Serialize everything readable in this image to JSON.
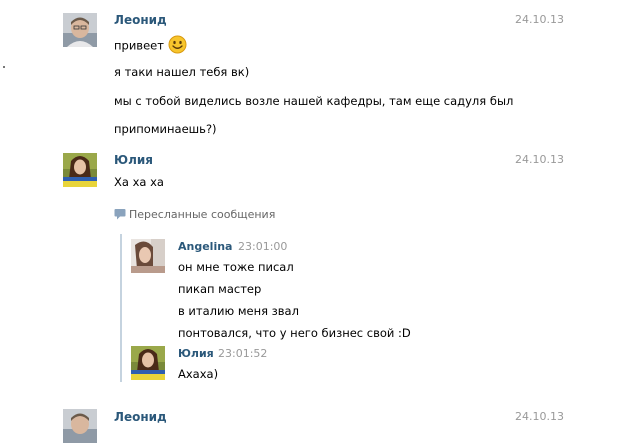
{
  "messages": [
    {
      "author": "Леонид",
      "date": "24.10.13",
      "lines": [
        "привеет",
        "я таки нашел тебя вк)",
        "мы с тобой виделись возле нашей кафедры, там еще садуля был",
        "припоминаешь?)"
      ],
      "emoji": "smiling-face-emoji"
    },
    {
      "author": "Юлия",
      "date": "24.10.13",
      "lines": [
        "Ха ха ха"
      ],
      "forwarded_label": "Пересланные сообщения",
      "forwarded": [
        {
          "author": "Angelina",
          "time": "23:01:00",
          "lines": [
            "он мне тоже писал",
            "пикап мастер",
            "в италию меня звал",
            "понтовался, что у него бизнес свой :D"
          ]
        },
        {
          "author": "Юлия",
          "time": "23:01:52",
          "lines": [
            "Ахаха)"
          ]
        }
      ]
    },
    {
      "author": "Леонид",
      "date": "24.10.13",
      "lines": []
    }
  ],
  "icons": {
    "forward_icon": "speech-bubble-icon"
  },
  "colors": {
    "author_link": "#2b587a",
    "date": "#999999",
    "forward_bar": "#c5d3df"
  }
}
